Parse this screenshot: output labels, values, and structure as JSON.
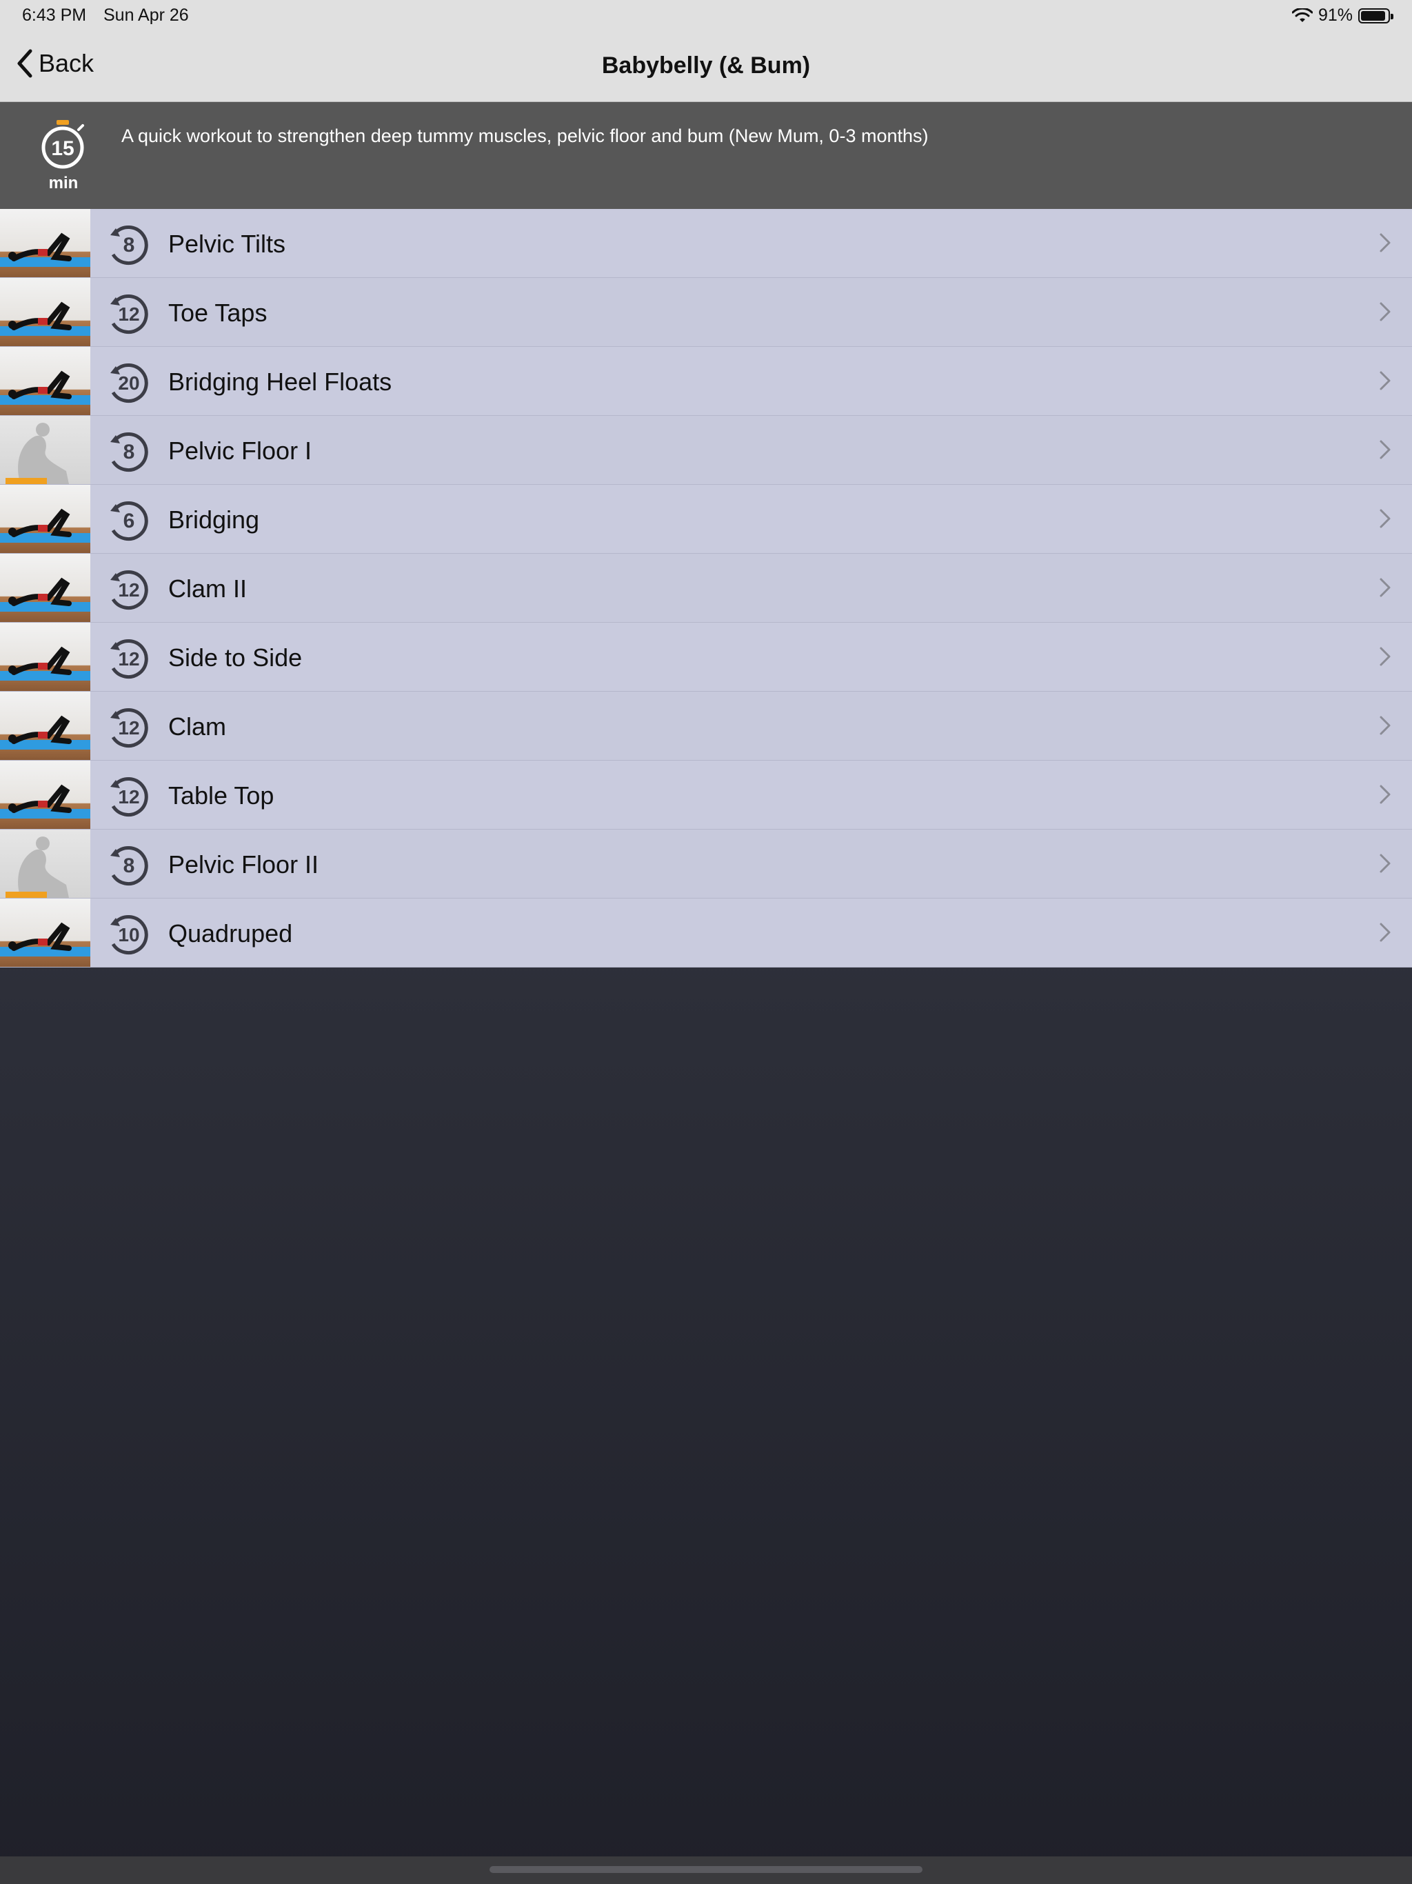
{
  "status_bar": {
    "time": "6:43 PM",
    "date": "Sun Apr 26",
    "battery_percent_label": "91%",
    "battery_level": 0.91
  },
  "nav": {
    "back_label": "Back",
    "title": "Babybelly (& Bum)"
  },
  "header": {
    "duration_value": "15",
    "duration_unit": "min",
    "description": "A quick workout to strengthen deep tummy muscles, pelvic floor and bum (New Mum, 0-3 months)"
  },
  "exercises": [
    {
      "name": "Pelvic Tilts",
      "reps": "8",
      "thumb": "photo"
    },
    {
      "name": "Toe Taps",
      "reps": "12",
      "thumb": "photo"
    },
    {
      "name": "Bridging Heel Floats",
      "reps": "20",
      "thumb": "photo"
    },
    {
      "name": "Pelvic Floor I",
      "reps": "8",
      "thumb": "gray"
    },
    {
      "name": "Bridging",
      "reps": "6",
      "thumb": "photo"
    },
    {
      "name": "Clam II",
      "reps": "12",
      "thumb": "photo"
    },
    {
      "name": "Side to Side",
      "reps": "12",
      "thumb": "photo"
    },
    {
      "name": "Clam",
      "reps": "12",
      "thumb": "photo"
    },
    {
      "name": "Table Top",
      "reps": "12",
      "thumb": "photo"
    },
    {
      "name": "Pelvic Floor II",
      "reps": "8",
      "thumb": "gray"
    },
    {
      "name": "Quadruped",
      "reps": "10",
      "thumb": "photo"
    }
  ],
  "colors": {
    "accent_orange": "#f0a020",
    "row_bg": "#c7c9dc",
    "header_bg": "#575757"
  }
}
